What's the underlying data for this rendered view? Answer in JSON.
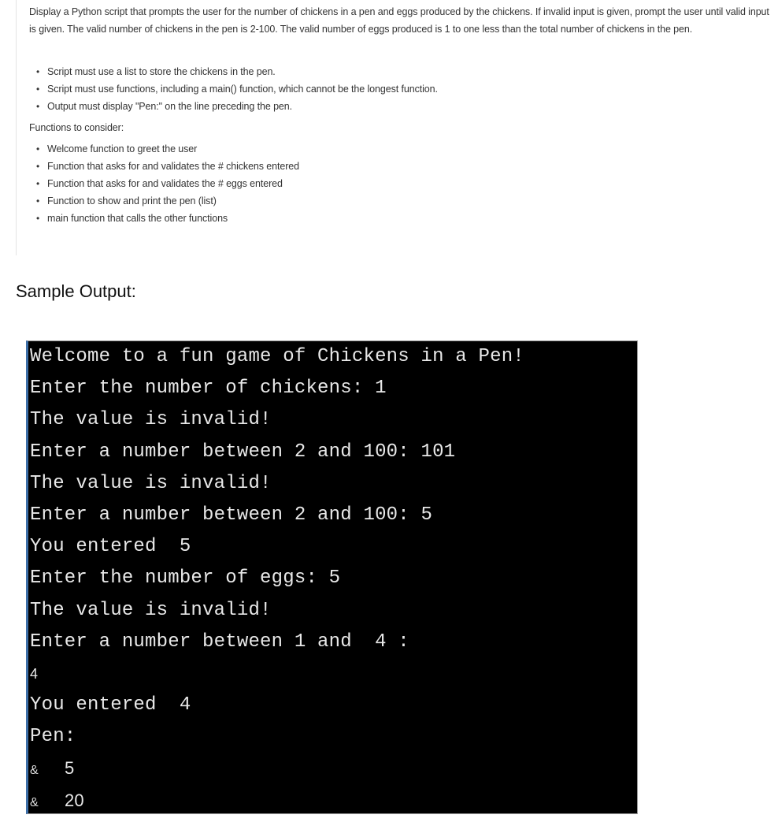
{
  "description": {
    "intro": "Display a Python script that prompts the user for the number of chickens in a pen and eggs produced by the chickens. If invalid input is given, prompt the user until valid input is given. The valid number of chickens in the pen is 2-100. The valid number of eggs produced is 1 to one less than the total number of chickens in the pen.",
    "requirements": [
      "Script must use a list to store the chickens in the pen.",
      "Script must use functions, including a main() function, which cannot be the longest function.",
      "Output must display \"Pen:\" on the line preceding the pen."
    ],
    "functions_heading": "Functions to consider:",
    "functions": [
      "Welcome function to greet the user",
      "Function that asks for and validates the # chickens entered",
      "Function that asks for and validates the # eggs entered",
      "Function to show and print the pen (list)",
      "main function that calls the other functions"
    ],
    "bullet_glyph": "•"
  },
  "sample_output": {
    "title": "Sample Output:",
    "lines": [
      "Welcome to a fun game of Chickens in a Pen!",
      "Enter the number of chickens: 1",
      "The value is invalid!",
      "Enter a number between 2 and 100: 101",
      "The value is invalid!",
      "Enter a number between 2 and 100: 5",
      "You entered  5",
      "Enter the number of eggs: 5",
      "The value is invalid!",
      "Enter a number between 1 and  4 :",
      "4",
      "You entered  4",
      "Pen:"
    ],
    "pen_rows": [
      {
        "symbol": "&",
        "value": "5"
      },
      {
        "symbol": "&",
        "value": "20"
      }
    ]
  },
  "colors": {
    "terminal_bg": "#000000",
    "terminal_text": "#e8e8e8",
    "terminal_left_accent": "#3d6fa8"
  }
}
